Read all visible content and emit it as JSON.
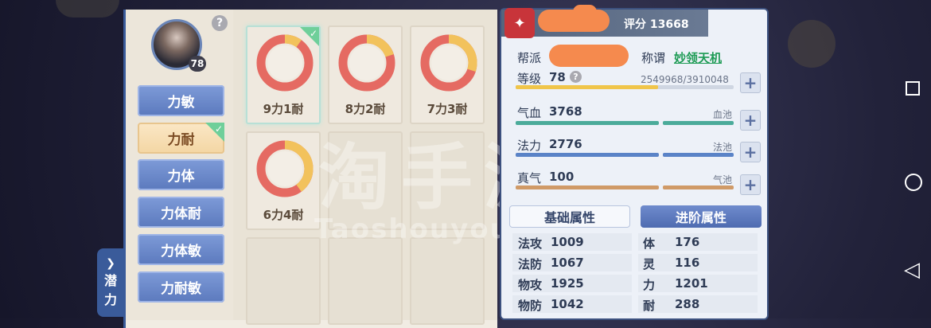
{
  "left": {
    "avatar_level": "78",
    "help": "?",
    "plans": [
      {
        "label": "力敏",
        "selected": false
      },
      {
        "label": "力耐",
        "selected": true
      },
      {
        "label": "力体",
        "selected": false
      },
      {
        "label": "力体耐",
        "selected": false
      },
      {
        "label": "力体敏",
        "selected": false
      },
      {
        "label": "力耐敏",
        "selected": false
      }
    ],
    "side_tab": {
      "arrow": "❯",
      "line1": "潜",
      "line2": "力"
    },
    "slots": [
      {
        "label": "9力1耐",
        "strength": 9,
        "endurance": 1,
        "selected": true
      },
      {
        "label": "8力2耐",
        "strength": 8,
        "endurance": 2,
        "selected": false
      },
      {
        "label": "7力3耐",
        "strength": 7,
        "endurance": 3,
        "selected": false
      },
      {
        "label": "6力4耐",
        "strength": 6,
        "endurance": 4,
        "selected": false
      }
    ],
    "donut_colors": {
      "main": "#e56a62",
      "secondary": "#f2c25c"
    },
    "check_mark": "✓"
  },
  "right": {
    "score_label": "评分",
    "score_value": "13668",
    "guild_label": "帮派",
    "title_label": "称谓",
    "title_value": "妙领天机",
    "level_label": "等级",
    "level_value": "78",
    "exp_text": "2549968/3910048",
    "exp_fraction": 0.652,
    "hp_label": "气血",
    "hp_value": "3768",
    "hp_pool": "血池",
    "mp_label": "法力",
    "mp_value": "2776",
    "mp_pool": "法池",
    "qi_label": "真气",
    "qi_value": "100",
    "qi_pool": "气池",
    "plus": "+",
    "tabs": {
      "basic": "基础属性",
      "advanced": "进阶属性"
    },
    "stats_left": [
      {
        "label": "法攻",
        "value": "1009"
      },
      {
        "label": "法防",
        "value": "1067"
      },
      {
        "label": "物攻",
        "value": "1925"
      },
      {
        "label": "物防",
        "value": "1042"
      }
    ],
    "stats_right": [
      {
        "label": "体",
        "value": "176"
      },
      {
        "label": "灵",
        "value": "116"
      },
      {
        "label": "力",
        "value": "1201"
      },
      {
        "label": "耐",
        "value": "288"
      }
    ],
    "colors": {
      "accent": "#3a5b9a",
      "title_green": "#1e9b55",
      "redaction": "#f58a4e"
    }
  },
  "watermark": {
    "cn": "淘手游",
    "en": "Taoshouyou.com"
  },
  "nav": {
    "back": "◁"
  }
}
